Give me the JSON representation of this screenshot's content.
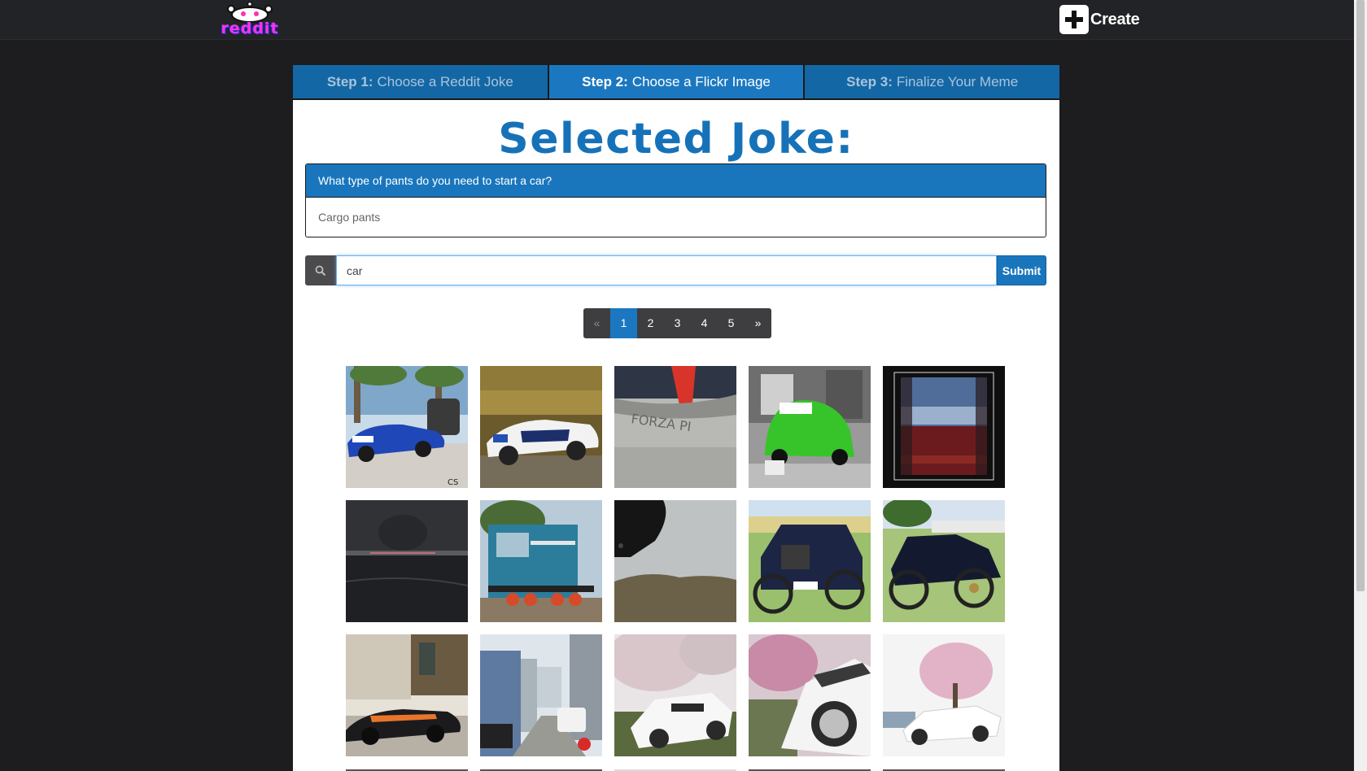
{
  "brand": {
    "logo_text": "reddit"
  },
  "header": {
    "create_label": "Create"
  },
  "tabs": [
    {
      "step": "Step 1:",
      "label": "Choose a Reddit Joke"
    },
    {
      "step": "Step 2:",
      "label": "Choose a Flickr Image"
    },
    {
      "step": "Step 3:",
      "label": "Finalize Your Meme"
    }
  ],
  "main": {
    "title": "Selected Joke:",
    "joke": {
      "question": "What type of pants do you need to start a car?",
      "answer": "Cargo pants"
    },
    "search": {
      "value": "car",
      "submit_label": "Submit",
      "icon": "search-icon"
    }
  },
  "pagination": {
    "prev": "«",
    "pages": [
      "1",
      "2",
      "3",
      "4",
      "5"
    ],
    "next": "»",
    "active_page": "1"
  },
  "images": [
    "blue-sports-car",
    "rally-car-motion-blur",
    "car-dashboard-closeup",
    "green-2cv-car",
    "car-through-curtain-window",
    "night-road-light-trails",
    "blue-locomotive",
    "car-mirror-hills",
    "vintage-ford-model-t",
    "vintage-black-car-show",
    "black-supercar-street",
    "city-street-parked-cars",
    "white-sports-car-cherry-blossoms",
    "white-car-closeup-blossoms",
    "white-car-pink-tree"
  ],
  "colors": {
    "accent": "#1b78c0",
    "tab_inactive": "#1467a5",
    "title": "#1672b8",
    "background": "#1d1d1f",
    "logo_pink": "#ff33dd"
  }
}
